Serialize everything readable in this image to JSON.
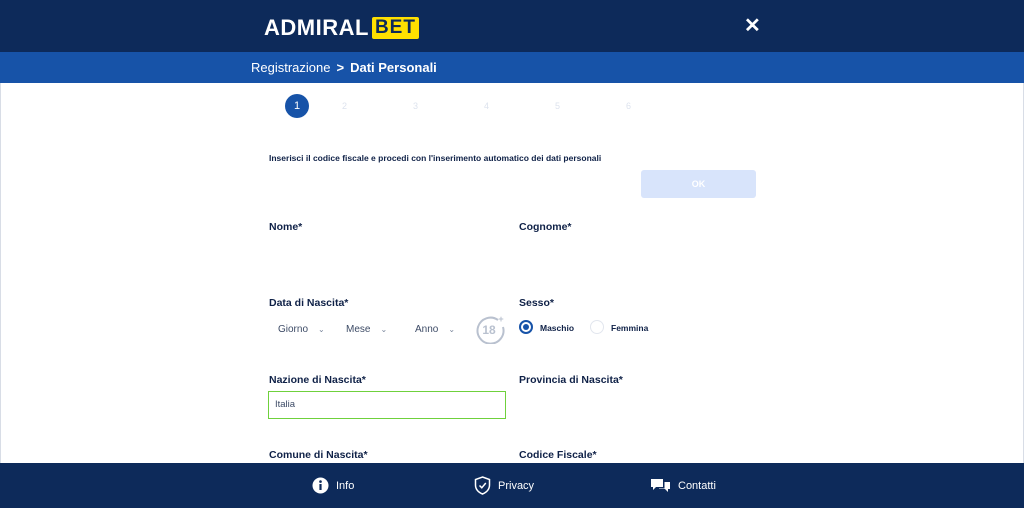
{
  "header": {
    "logo_text_a": "ADMIRAL",
    "logo_text_b": "BET",
    "close_icon": "close-icon"
  },
  "breadcrumb": {
    "parent": "Registrazione",
    "separator": ">",
    "current": "Dati Personali"
  },
  "steps": {
    "active": "1",
    "others": [
      "2",
      "3",
      "4",
      "5",
      "6"
    ]
  },
  "form": {
    "intro": "Inserisci il codice fiscale e procedi con l'inserimento automatico dei dati personali",
    "ok_label": "OK",
    "nome_label": "Nome*",
    "cognome_label": "Cognome*",
    "data_label": "Data di Nascita*",
    "giorno": "Giorno",
    "mese": "Mese",
    "anno": "Anno",
    "badge": "18+",
    "sesso_label": "Sesso*",
    "maschio": "Maschio",
    "femmina": "Femmina",
    "sesso_selected": "Maschio",
    "nazione_label": "Nazione di Nascita*",
    "nazione_value": "Italia",
    "provincia_label": "Provincia di Nascita*",
    "comune_label": "Comune di Nascita*",
    "codice_label": "Codice Fiscale*"
  },
  "footer": {
    "info": "Info",
    "privacy": "Privacy",
    "contatti": "Contatti"
  },
  "colors": {
    "navy": "#0d2a5a",
    "blue": "#1753a8",
    "accent_yellow": "#ffe000",
    "valid_green": "#6fd13c"
  }
}
